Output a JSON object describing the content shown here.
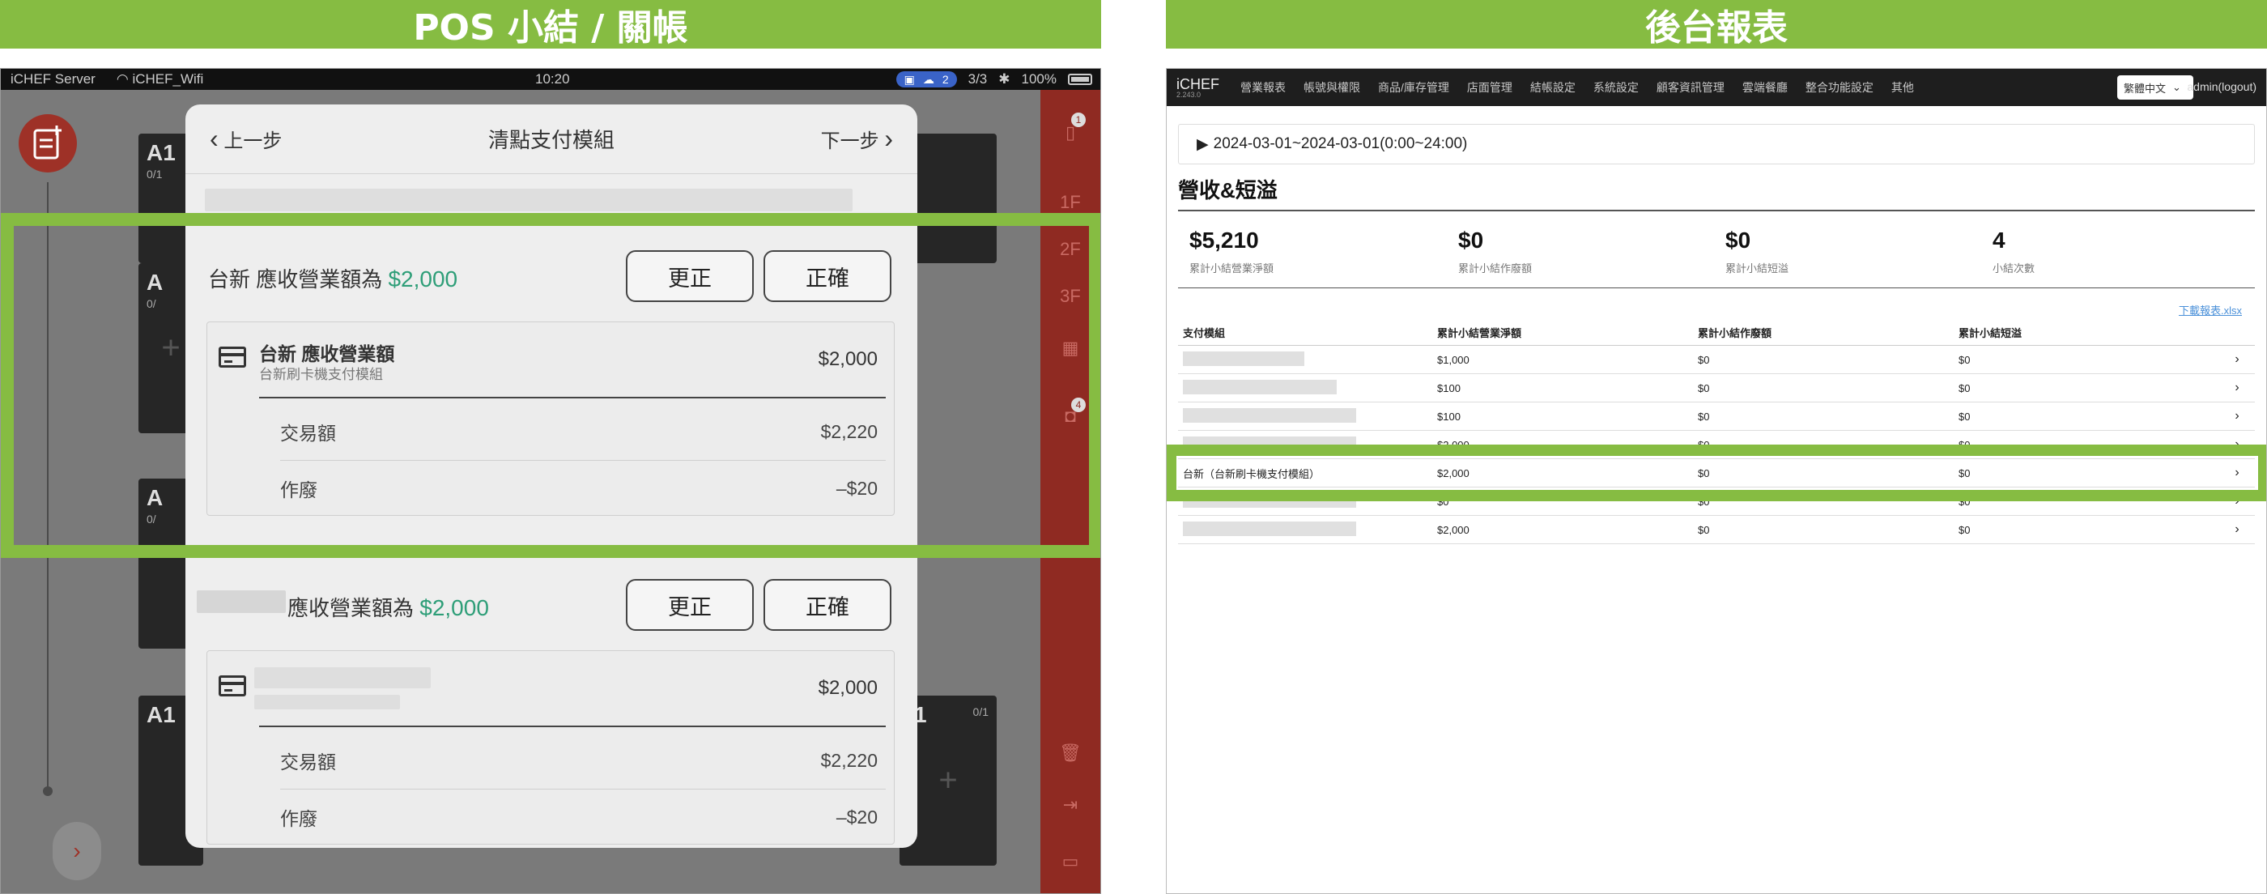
{
  "banners": {
    "left": "POS 小結 / 關帳",
    "right": "後台報表"
  },
  "pos": {
    "status": {
      "left1": "iCHEF Server",
      "left2": "iCHEF_Wifi",
      "time": "10:20",
      "badge": "2",
      "right": "3/3",
      "battery": "100%"
    },
    "side_labels": {
      "floor1": "1F",
      "floor2": "2F",
      "floor3": "3F",
      "badge1": "1",
      "badge2": "4"
    },
    "tables": [
      {
        "name": "A1",
        "count": "0/1"
      },
      {
        "name": "A",
        "count": "0/"
      },
      {
        "name": "A",
        "count": "0/"
      },
      {
        "name": "A1",
        "count": ""
      },
      {
        "name": "1",
        "count": "0/1"
      }
    ],
    "dialog": {
      "back": "上一步",
      "title": "清點支付模組",
      "next": "下一步",
      "section1": {
        "prefix": "台新 應收營業額為",
        "amount": "$2,000",
        "btn_fix": "更正",
        "btn_ok": "正確",
        "box_name": "台新 應收營業額",
        "box_sub": "台新刷卡機支付模組",
        "box_amount": "$2,000",
        "rows": [
          {
            "label": "交易額",
            "value": "$2,220"
          },
          {
            "label": "作廢",
            "value": "–$20"
          }
        ]
      },
      "section2": {
        "prefix": "應收營業額為",
        "amount": "$2,000",
        "btn_fix": "更正",
        "btn_ok": "正確",
        "box_amount": "$2,000",
        "rows": [
          {
            "label": "交易額",
            "value": "$2,220"
          },
          {
            "label": "作廢",
            "value": "–$20"
          }
        ]
      }
    }
  },
  "backoffice": {
    "brand": "iCHEF",
    "version": "2.243.0",
    "nav": [
      "營業報表",
      "帳號與權限",
      "商品/庫存管理",
      "店面管理",
      "結帳設定",
      "系統設定",
      "顧客資訊管理",
      "雲端餐廳",
      "整合功能設定",
      "其他"
    ],
    "language": "繁體中文",
    "admin": "admin(logout)",
    "date_range": "2024-03-01~2024-03-01(0:00~24:00)",
    "heading": "營收&短溢",
    "stats": [
      {
        "value": "$5,210",
        "label": "累計小結營業淨額"
      },
      {
        "value": "$0",
        "label": "累計小結作廢額"
      },
      {
        "value": "$0",
        "label": "累計小結短溢"
      },
      {
        "value": "4",
        "label": "小結次數"
      }
    ],
    "download": "下載報表.xlsx",
    "table": {
      "headers": [
        "支付模組",
        "累計小結營業淨額",
        "累計小結作廢額",
        "累計小結短溢"
      ],
      "rows": [
        {
          "name": "",
          "net": "$1,000",
          "void": "$0",
          "diff": "$0"
        },
        {
          "name": "",
          "net": "$100",
          "void": "$0",
          "diff": "$0"
        },
        {
          "name": "",
          "net": "$100",
          "void": "$0",
          "diff": "$0"
        },
        {
          "name": "",
          "net": "$2,000",
          "void": "$0",
          "diff": "$0"
        },
        {
          "name": "台新（台新刷卡機支付模組）",
          "net": "$2,000",
          "void": "$0",
          "diff": "$0"
        },
        {
          "name": "",
          "net": "$0",
          "void": "$0",
          "diff": "$0"
        },
        {
          "name": "",
          "net": "$2,000",
          "void": "$0",
          "diff": "$0"
        }
      ]
    }
  }
}
